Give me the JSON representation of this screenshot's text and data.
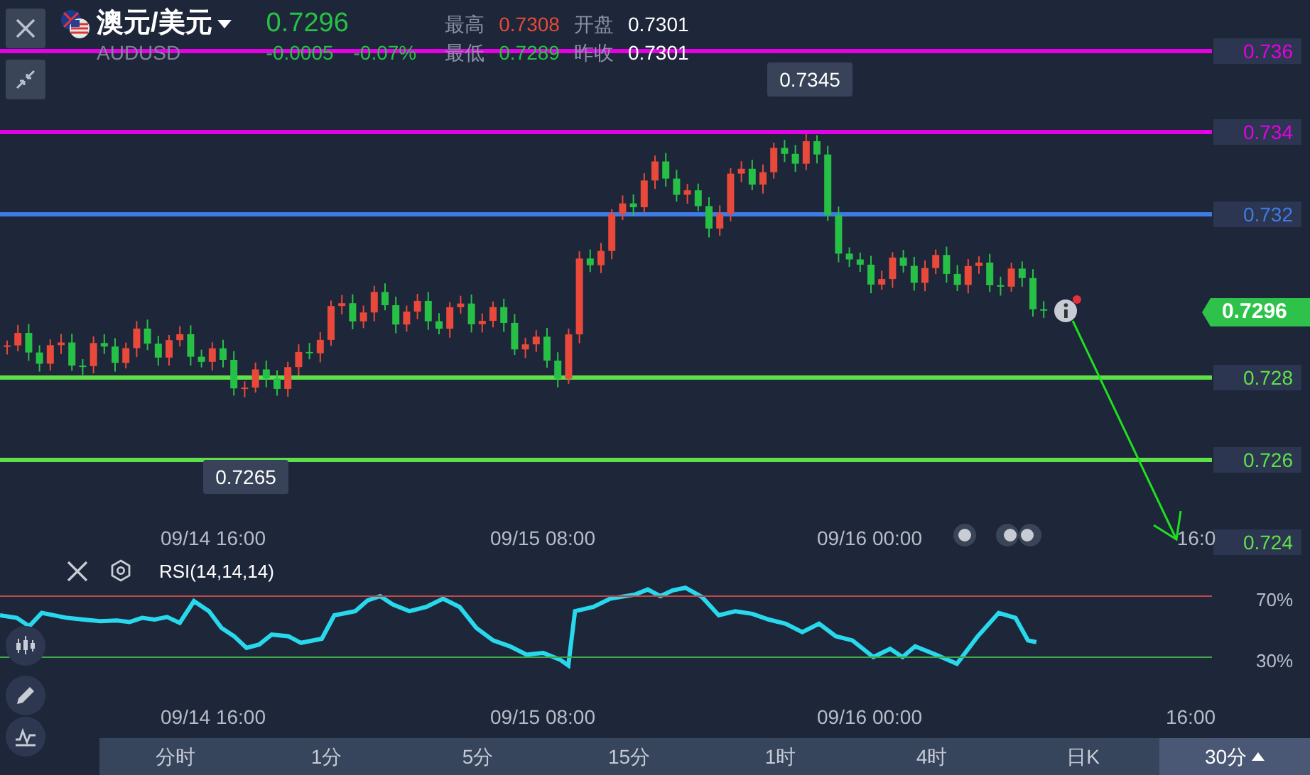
{
  "header": {
    "symbol": "澳元/美元",
    "code": "AUDUSD",
    "price": "0.7296",
    "change": "-0.0005",
    "change_pct": "-0.07%",
    "stats": [
      {
        "label": "最高",
        "value": "0.7308",
        "kind": "up"
      },
      {
        "label": "开盘",
        "value": "0.7301",
        "kind": "neutral"
      },
      {
        "label": "最低",
        "value": "0.7289",
        "kind": "down"
      },
      {
        "label": "昨收",
        "value": "0.7301",
        "kind": "neutral"
      }
    ]
  },
  "levels": [
    {
      "label": "0.736",
      "color": "#e600e6"
    },
    {
      "label": "0.734",
      "color": "#e600e6"
    },
    {
      "label": "0.732",
      "color": "#3f7be6"
    },
    {
      "label": "0.728",
      "color": "#5fe04a"
    },
    {
      "label": "0.726",
      "color": "#5fe04a"
    }
  ],
  "axis_label": "0.724",
  "current_price": "0.7296",
  "high_callout": "0.7345",
  "low_callout": "0.7265",
  "time_axis": [
    "09/14 16:00",
    "09/15 08:00",
    "09/16 00:00",
    "16:0"
  ],
  "rsi": {
    "label": "RSI(14,14,14)",
    "ticks": [
      "70%",
      "30%"
    ],
    "time_axis": [
      "09/14 16:00",
      "09/15 08:00",
      "09/16 00:00",
      "16:00"
    ]
  },
  "periods": [
    {
      "label": "分时",
      "selected": false
    },
    {
      "label": "1分",
      "selected": false
    },
    {
      "label": "5分",
      "selected": false
    },
    {
      "label": "15分",
      "selected": false
    },
    {
      "label": "1时",
      "selected": false
    },
    {
      "label": "4时",
      "selected": false
    },
    {
      "label": "日K",
      "selected": false
    },
    {
      "label": "30分",
      "selected": true
    }
  ]
}
